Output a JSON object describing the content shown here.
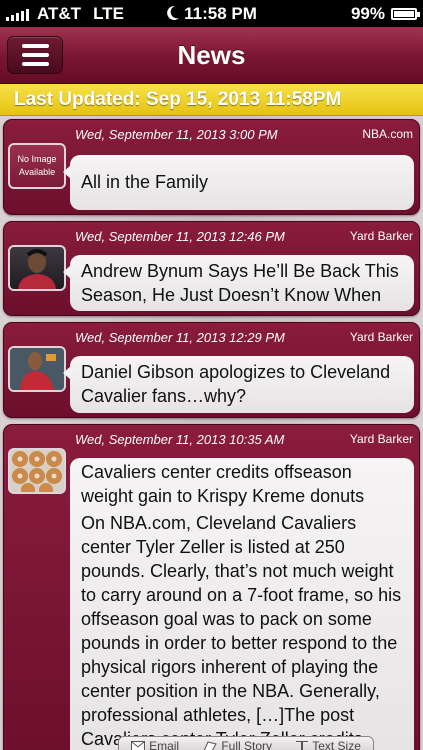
{
  "status_bar": {
    "carrier": "AT&T",
    "network": "LTE",
    "time": "11:58 PM",
    "battery": "99%",
    "battery_level": 0.99
  },
  "nav": {
    "title": "News",
    "menu_icon": "hamburger-menu-icon"
  },
  "updated": {
    "text": "Last Updated: Sep 15, 2013 11:58PM"
  },
  "articles": [
    {
      "date": "Wed, September 11, 2013 3:00 PM",
      "source": "NBA.com",
      "thumb": "No Image Available",
      "title": "All in the Family",
      "body": ""
    },
    {
      "date": "Wed, September 11, 2013 12:46 PM",
      "source": "Yard Barker",
      "thumb": "",
      "title": "Andrew Bynum Says He’ll Be Back This Season, He Just Doesn’t Know When",
      "body": ""
    },
    {
      "date": "Wed, September 11, 2013 12:29 PM",
      "source": "Yard Barker",
      "thumb": "",
      "title": "Daniel Gibson apologizes to Cleveland Cavalier fans…why?",
      "body": ""
    },
    {
      "date": "Wed, September 11, 2013 10:35 AM",
      "source": "Yard Barker",
      "thumb": "",
      "title": "Cavaliers center credits offseason weight gain to Krispy Kreme donuts",
      "body": "On NBA.com, Cleveland Cavaliers center Tyler Zeller is listed at 250 pounds. Clearly, that’s not much weight to carry around on a 7-foot frame, so his offseason goal was to pack on some pounds in order to better respond to the physical rigors inherent of playing the center position in the NBA. Generally, professional athletes, […]The post Cavaliers center Tyler Zeller credits"
    }
  ],
  "toolbar": {
    "email": "Email",
    "full_story": "Full Story",
    "text_size": "Text Size"
  },
  "colors": {
    "header": "#7a1533",
    "updated_bar": "#f0d42c"
  }
}
